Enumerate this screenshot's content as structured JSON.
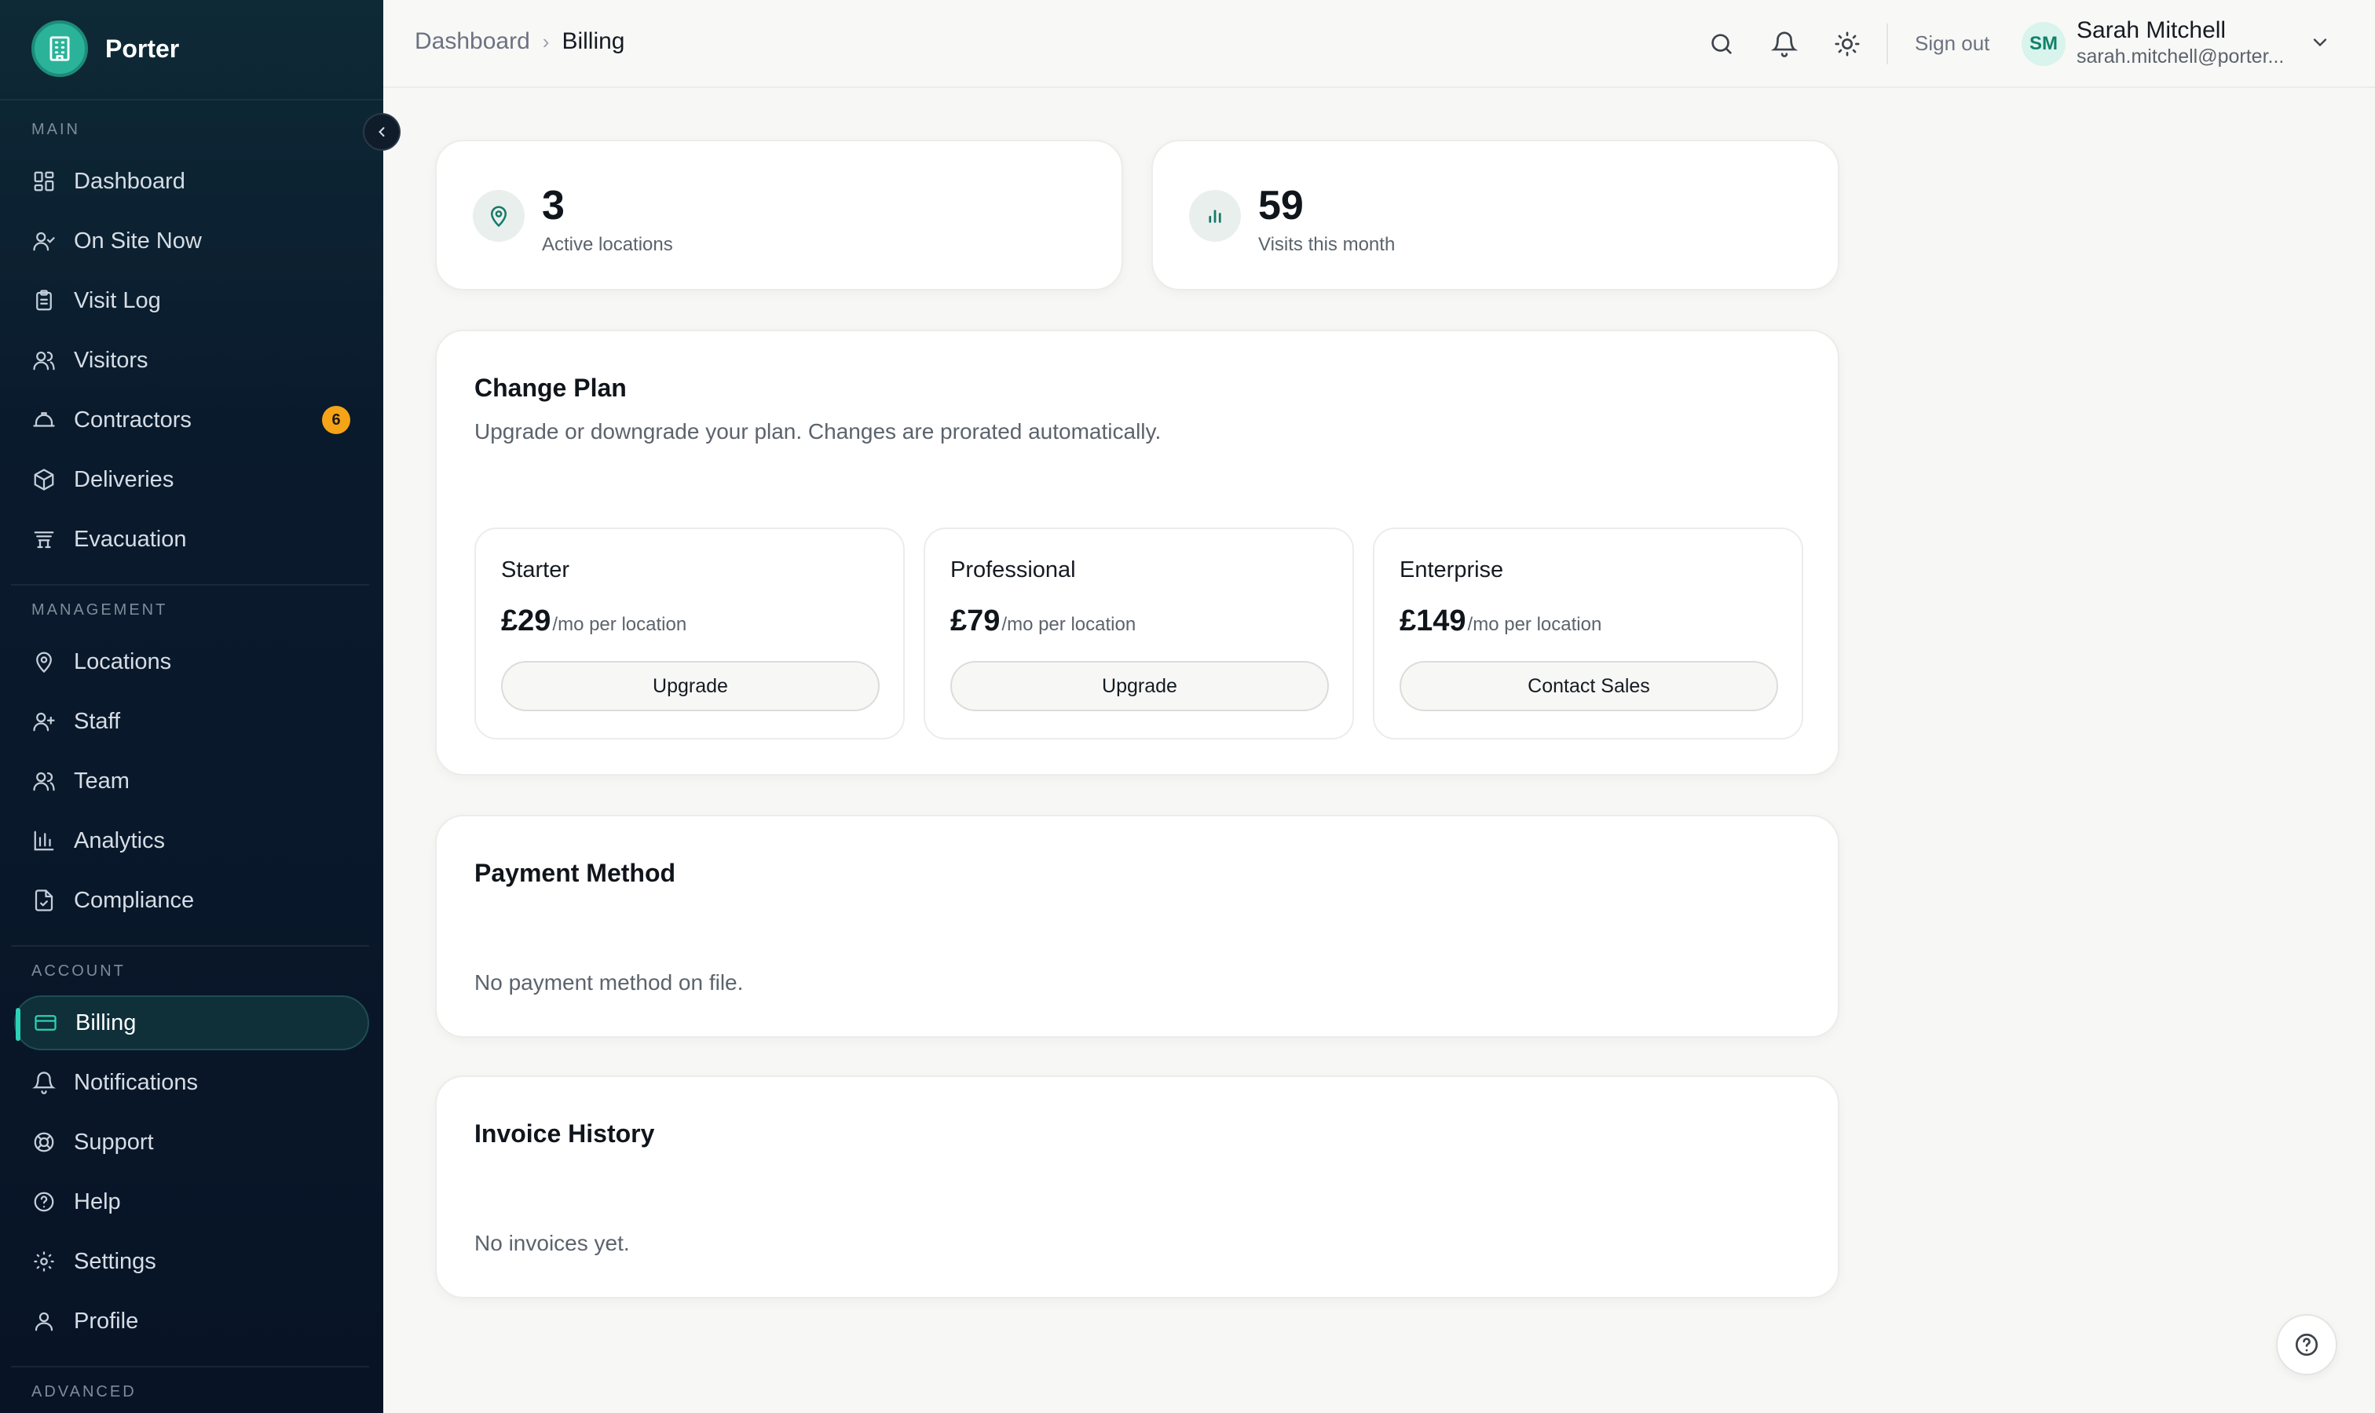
{
  "brand": {
    "name": "Porter"
  },
  "sidebar": {
    "sections": {
      "main": "Main",
      "management": "Management",
      "account": "Account",
      "advanced": "Advanced"
    },
    "items": [
      {
        "label": "Dashboard",
        "icon": "dashboard-icon"
      },
      {
        "label": "On Site Now",
        "icon": "user-check-icon"
      },
      {
        "label": "Visit Log",
        "icon": "clipboard-icon"
      },
      {
        "label": "Visitors",
        "icon": "users-icon"
      },
      {
        "label": "Contractors",
        "icon": "hard-hat-icon",
        "badge": "6"
      },
      {
        "label": "Deliveries",
        "icon": "package-icon"
      },
      {
        "label": "Evacuation",
        "icon": "alarm-icon"
      },
      {
        "label": "Locations",
        "icon": "map-pin-icon"
      },
      {
        "label": "Staff",
        "icon": "user-plus-icon"
      },
      {
        "label": "Team",
        "icon": "users-icon"
      },
      {
        "label": "Analytics",
        "icon": "bar-chart-icon"
      },
      {
        "label": "Compliance",
        "icon": "file-check-icon"
      },
      {
        "label": "Billing",
        "icon": "credit-card-icon",
        "active": true
      },
      {
        "label": "Notifications",
        "icon": "bell-icon"
      },
      {
        "label": "Support",
        "icon": "life-buoy-icon"
      },
      {
        "label": "Help",
        "icon": "help-circle-icon"
      },
      {
        "label": "Settings",
        "icon": "gear-icon"
      },
      {
        "label": "Profile",
        "icon": "user-icon"
      }
    ]
  },
  "header": {
    "breadcrumb": [
      "Dashboard",
      "Billing"
    ],
    "sign_out": "Sign out",
    "user": {
      "initials": "SM",
      "name": "Sarah Mitchell",
      "email": "sarah.mitchell@porter..."
    }
  },
  "stats": [
    {
      "value": "3",
      "label": "Active locations"
    },
    {
      "value": "59",
      "label": "Visits this month"
    }
  ],
  "change_plan": {
    "title": "Change Plan",
    "subtitle": "Upgrade or downgrade your plan. Changes are prorated automatically.",
    "plans": [
      {
        "name": "Starter",
        "price": "£29",
        "unit": "/mo per location",
        "action": "Upgrade"
      },
      {
        "name": "Professional",
        "price": "£79",
        "unit": "/mo per location",
        "action": "Upgrade"
      },
      {
        "name": "Enterprise",
        "price": "£149",
        "unit": "/mo per location",
        "action": "Contact Sales"
      }
    ]
  },
  "payment_method": {
    "title": "Payment Method",
    "empty": "No payment method on file."
  },
  "invoice_history": {
    "title": "Invoice History",
    "empty": "No invoices yet."
  },
  "colors": {
    "accent": "#2bd2b4",
    "sidebar_bg": "#0a1a2d",
    "badge": "#f5a417"
  }
}
